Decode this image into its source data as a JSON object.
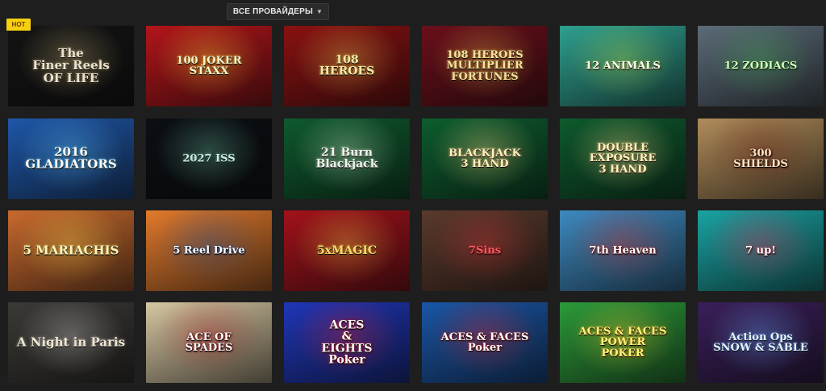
{
  "header": {
    "provider_filter_label": "ВСЕ ПРОВАЙДЕРЫ",
    "provider_filter_icon": "chevron-down-icon"
  },
  "badges": {
    "hot": "HOT"
  },
  "games": [
    {
      "id": "finer-reels-of-life",
      "title": "The\nFiner Reels\nOF LIFE",
      "bg": "#141414",
      "accent": "#c9b27a",
      "text": "#e9e3d2"
    },
    {
      "id": "100-joker-staxx",
      "title": "100 JOKER\nSTAXX",
      "bg": "#b3151a",
      "accent": "#ffcc33",
      "text": "#fff2d0"
    },
    {
      "id": "108-heroes",
      "title": "108\nHEROES",
      "bg": "#8a1111",
      "accent": "#f3c451",
      "text": "#fbe7a8"
    },
    {
      "id": "108-heroes-multiplier-fortunes",
      "title": "108 HEROES\nMULTIPLIER\nFORTUNES",
      "bg": "#6b0f1a",
      "accent": "#e8b54a",
      "text": "#fbe0a0"
    },
    {
      "id": "12-animals",
      "title": "12 ANIMALS",
      "bg": "#2fa08f",
      "accent": "#b8e04a",
      "text": "#ffffff"
    },
    {
      "id": "12-zodiacs",
      "title": "12 ZODIACS",
      "bg": "#5c6b78",
      "accent": "#3fae52",
      "text": "#d9f7c0"
    },
    {
      "id": "2016-gladiators",
      "title": "2016 GLADIATORS",
      "bg": "#1f57a9",
      "accent": "#5ec7ff",
      "text": "#ffffff"
    },
    {
      "id": "2027-iss",
      "title": "2027 ISS",
      "bg": "#0b0f14",
      "accent": "#6ec0a7",
      "text": "#cfe7e0"
    },
    {
      "id": "21-burn-blackjack",
      "title": "21 Burn\nBlackjack",
      "bg": "#0e5a2e",
      "accent": "#c8e8c6",
      "text": "#eef7ee"
    },
    {
      "id": "blackjack-3-hand",
      "title": "BLACKJACK\n3 HAND",
      "bg": "#0d5d2f",
      "accent": "#ffe08a",
      "text": "#fff1bf"
    },
    {
      "id": "double-exposure-3-hand",
      "title": "DOUBLE\nEXPOSURE\n3 HAND",
      "bg": "#0e5a2e",
      "accent": "#ffe08a",
      "text": "#fff1bf"
    },
    {
      "id": "300-shields",
      "title": "300\nSHIELDS",
      "bg": "#b08c5a",
      "accent": "#6b1d10",
      "text": "#fbe9c5"
    },
    {
      "id": "5-mariachis",
      "title": "5 MARIACHIS",
      "bg": "#c96a2e",
      "accent": "#f3d24a",
      "text": "#fff1c0"
    },
    {
      "id": "5-reel-drive",
      "title": "5 Reel Drive",
      "bg": "#e27a2c",
      "accent": "#1f4e96",
      "text": "#ffffff"
    },
    {
      "id": "5x-magic",
      "title": "5xMAGIC",
      "bg": "#a3121b",
      "accent": "#f4c543",
      "text": "#ffd86b"
    },
    {
      "id": "7-sins",
      "title": "7Sins",
      "bg": "#5a3a2c",
      "accent": "#e0333a",
      "text": "#ff5a5f"
    },
    {
      "id": "7th-heaven",
      "title": "7th Heaven",
      "bg": "#3e8ac0",
      "accent": "#d82c2c",
      "text": "#ffffff"
    },
    {
      "id": "7-up",
      "title": "7 up!",
      "bg": "#1aa3a3",
      "accent": "#e8315d",
      "text": "#ffffff"
    },
    {
      "id": "a-night-in-paris",
      "title": "A Night in Paris",
      "bg": "#3c3a36",
      "accent": "#cfcfcf",
      "text": "#f1e7d0"
    },
    {
      "id": "ace-of-spades",
      "title": "ACE OF\nSPADES",
      "bg": "#d6c7a2",
      "accent": "#a6141a",
      "text": "#ffffff"
    },
    {
      "id": "aces-and-eights-poker",
      "title": "ACES\n&\nEIGHTS\nPoker",
      "bg": "#1f36b8",
      "accent": "#e4202c",
      "text": "#ffffff"
    },
    {
      "id": "aces-and-faces-poker",
      "title": "ACES & FACES\nPoker",
      "bg": "#1a56a6",
      "accent": "#e4202c",
      "text": "#ffffff"
    },
    {
      "id": "aces-and-faces-power-poker",
      "title": "ACES & FACES\nPOWER\nPOKER",
      "bg": "#2c9a3a",
      "accent": "#f3c92b",
      "text": "#fff27a"
    },
    {
      "id": "action-ops-snow-and-sable",
      "title": "Action Ops\nSNOW & SABLE",
      "bg": "#3a1f5a",
      "accent": "#6aa8ff",
      "text": "#e8f1ff"
    }
  ]
}
